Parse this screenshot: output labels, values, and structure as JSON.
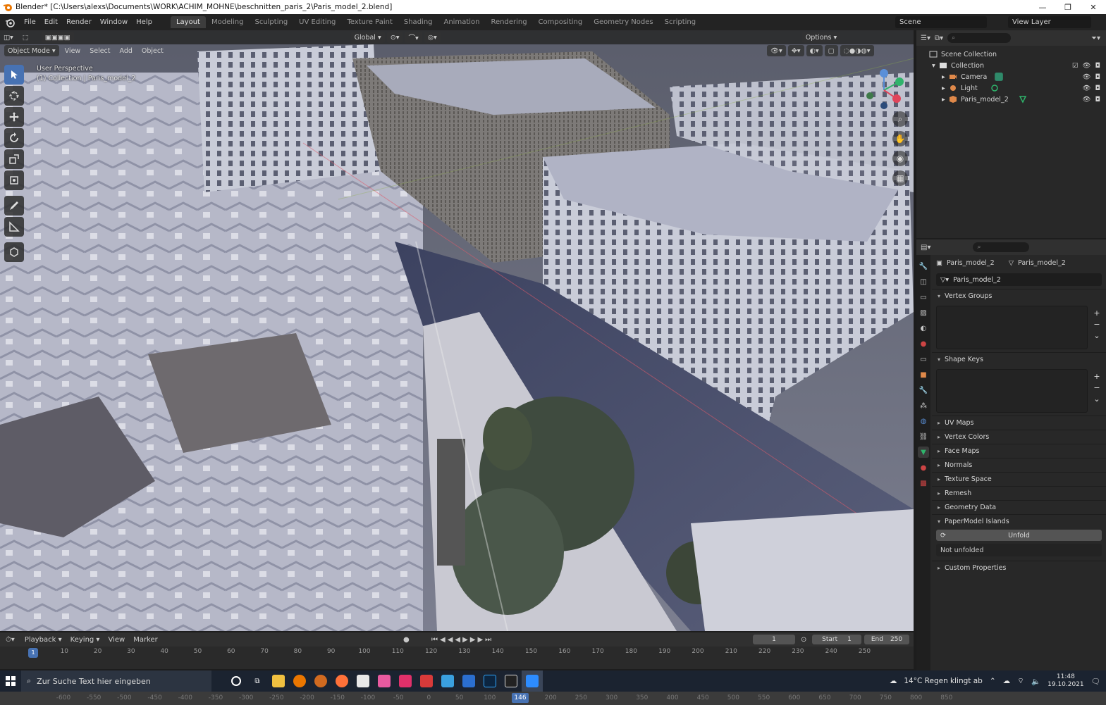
{
  "window": {
    "title": "Blender* [C:\\Users\\alexs\\Documents\\WORK\\ACHIM_MOHNE\\beschnitten_paris_2\\Paris_model_2.blend]",
    "minimize": "—",
    "maximize": "❐",
    "close": "✕"
  },
  "menu": {
    "items": [
      "File",
      "Edit",
      "Render",
      "Window",
      "Help"
    ]
  },
  "workspaces": {
    "tabs": [
      "Layout",
      "Modeling",
      "Sculpting",
      "UV Editing",
      "Texture Paint",
      "Shading",
      "Animation",
      "Rendering",
      "Compositing",
      "Geometry Nodes",
      "Scripting"
    ],
    "active": "Layout"
  },
  "scene": {
    "scene_name": "Scene",
    "view_layer": "View Layer"
  },
  "viewport": {
    "mode": "Object Mode",
    "menus": [
      "View",
      "Select",
      "Add",
      "Object"
    ],
    "orientation": "Global",
    "options": "Options",
    "overlay_line1": "User Perspective",
    "overlay_line2": "(1) Collection | Paris_model_2"
  },
  "outliner": {
    "search_placeholder": "",
    "rows": [
      {
        "label": "Scene Collection",
        "indent": 0
      },
      {
        "label": "Collection",
        "indent": 1
      },
      {
        "label": "Camera",
        "indent": 2
      },
      {
        "label": "Light",
        "indent": 2
      },
      {
        "label": "Paris_model_2",
        "indent": 2
      }
    ]
  },
  "properties": {
    "breadcrumb_object": "Paris_model_2",
    "breadcrumb_mesh": "Paris_model_2",
    "mesh_name": "Paris_model_2",
    "panels": {
      "vertex_groups": "Vertex Groups",
      "shape_keys": "Shape Keys",
      "uv_maps": "UV Maps",
      "vertex_colors": "Vertex Colors",
      "face_maps": "Face Maps",
      "normals": "Normals",
      "texture_space": "Texture Space",
      "remesh": "Remesh",
      "geometry_data": "Geometry Data",
      "papermodel": "PaperModel Islands",
      "custom_props": "Custom Properties"
    },
    "unfold_label": "Unfold",
    "not_unfolded": "Not unfolded"
  },
  "timeline": {
    "menus": [
      "Playback",
      "Keying",
      "View",
      "Marker"
    ],
    "current_frame": "1",
    "start_label": "Start",
    "start": "1",
    "end_label": "End",
    "end": "250",
    "ticks": [
      "0",
      "10",
      "20",
      "30",
      "40",
      "50",
      "60",
      "70",
      "80",
      "90",
      "100",
      "110",
      "120",
      "130",
      "140",
      "150",
      "160",
      "170",
      "180",
      "190",
      "200",
      "210",
      "220",
      "230",
      "240",
      "250"
    ]
  },
  "taskbar": {
    "search_placeholder": "Zur Suche Text hier eingeben",
    "weather": "14°C  Regen klingt ab",
    "time": "11:48",
    "date": "19.10.2021"
  },
  "bottom_ruler": {
    "ticks": [
      "-600",
      "-550",
      "-500",
      "-450",
      "-400",
      "-350",
      "-300",
      "-250",
      "-200",
      "-150",
      "-100",
      "-50",
      "0",
      "50",
      "100",
      "146",
      "200",
      "250",
      "300",
      "350",
      "400",
      "450",
      "500",
      "550",
      "600",
      "650",
      "700",
      "750",
      "800",
      "850"
    ],
    "highlight": "146"
  },
  "colors": {
    "accent": "#4772b3",
    "active_tool": "#4772b3",
    "mesh_green": "#2fb36b"
  }
}
